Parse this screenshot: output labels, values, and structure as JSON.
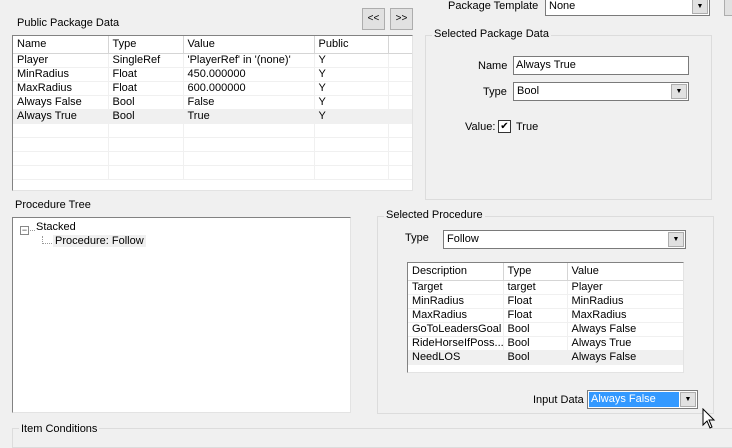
{
  "public_package": {
    "label": "Public Package Data",
    "prev_label": "<<",
    "next_label": ">>",
    "columns": [
      "Name",
      "Type",
      "Value",
      "Public"
    ],
    "rows": [
      [
        "Player",
        "SingleRef",
        "'PlayerRef' in '(none)'",
        "Y"
      ],
      [
        "MinRadius",
        "Float",
        "450.000000",
        "Y"
      ],
      [
        "MaxRadius",
        "Float",
        "600.000000",
        "Y"
      ],
      [
        "Always False",
        "Bool",
        "False",
        "Y"
      ],
      [
        "Always True",
        "Bool",
        "True",
        "Y"
      ]
    ]
  },
  "package_template": {
    "label": "Package Template",
    "value": "None"
  },
  "selected_package_data": {
    "title": "Selected Package Data",
    "name_label": "Name",
    "name_value": "Always True",
    "type_label": "Type",
    "type_value": "Bool",
    "value_label": "Value:",
    "value_checked": true,
    "value_text": "True"
  },
  "procedure_tree": {
    "label": "Procedure Tree",
    "root": "Stacked",
    "child": "Procedure: Follow"
  },
  "selected_procedure": {
    "title": "Selected Procedure",
    "type_label": "Type",
    "type_value": "Follow",
    "columns": [
      "Description",
      "Type",
      "Value"
    ],
    "rows": [
      [
        "Target",
        "target",
        "Player"
      ],
      [
        "MinRadius",
        "Float",
        "MinRadius"
      ],
      [
        "MaxRadius",
        "Float",
        "MaxRadius"
      ],
      [
        "GoToLeadersGoal",
        "Bool",
        "Always False"
      ],
      [
        "RideHorseIfPoss...",
        "Bool",
        "Always True"
      ],
      [
        "NeedLOS",
        "Bool",
        "Always False"
      ]
    ],
    "input_data_label": "Input Data",
    "input_data_value": "Always False"
  },
  "item_conditions": {
    "title": "Item Conditions"
  },
  "colors": {
    "selection": "#3399ff",
    "row_highlight": "#f0f0f0"
  }
}
